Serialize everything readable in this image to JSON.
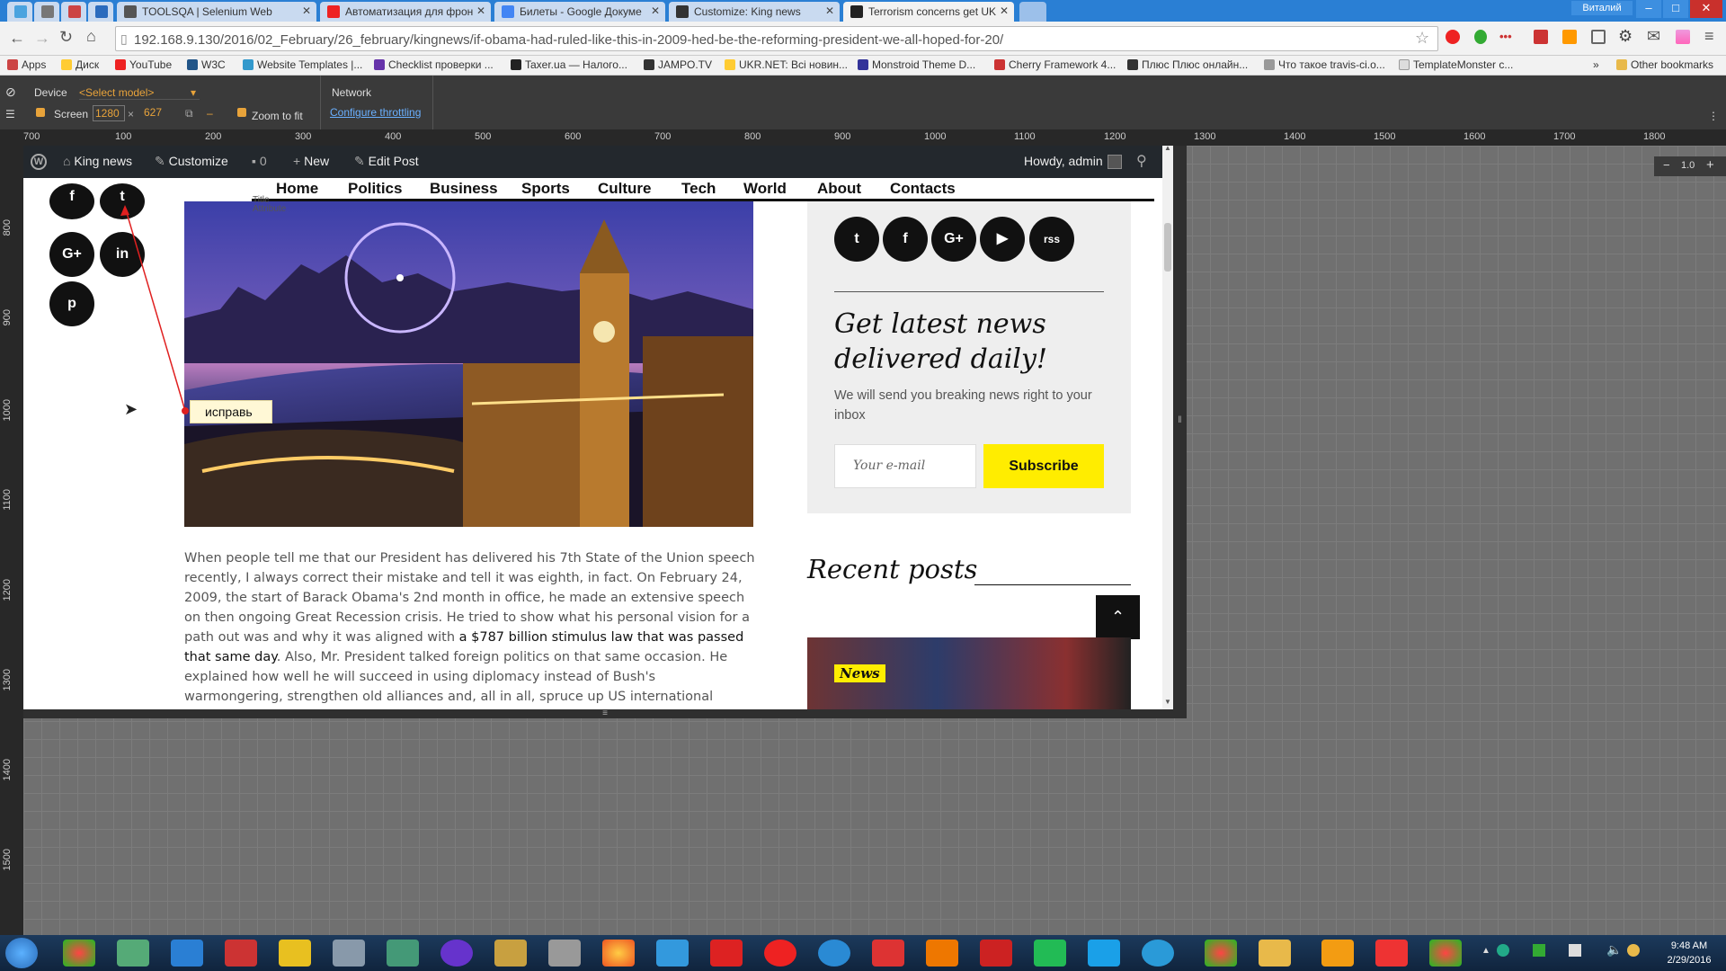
{
  "tabs": [
    {
      "label": "",
      "color": "#4aa3df"
    },
    {
      "label": "",
      "color": "#777"
    },
    {
      "label": "",
      "color": "#c44"
    },
    {
      "label": "",
      "color": "#2b6bbd"
    },
    {
      "label": "TOOLSQA | Selenium Web",
      "color": "#555"
    },
    {
      "label": "Автоматизация для фрон",
      "color": "#e22"
    },
    {
      "label": "Билеты - Google Докуме",
      "color": "#4285f4"
    },
    {
      "label": "Customize: King news",
      "color": "#333"
    },
    {
      "label": "Terrorism concerns get UK",
      "color": "#222"
    }
  ],
  "window": {
    "user": "Виталий",
    "min": "–",
    "max": "□",
    "close": "✕"
  },
  "address": {
    "url": "192.168.9.130/2016/02_February/26_february/kingnews/if-obama-had-ruled-like-this-in-2009-hed-be-the-reforming-president-we-all-hoped-for-20/"
  },
  "bookmarks": [
    "Apps",
    "Диск",
    "YouTube",
    "W3C",
    "Website Templates |...",
    "Checklist проверки ...",
    "Taxer.ua — Налого...",
    "JAMPO.TV",
    "UKR.NET: Всі новин...",
    "Monstroid Theme D...",
    "Cherry Framework 4...",
    "Плюс Плюс онлайн...",
    "Что такое travis-ci.o...",
    "TemplateMonster c...",
    "»",
    "Other bookmarks"
  ],
  "device": {
    "label": "Device",
    "model": "<Select model>",
    "screen_label": "Screen",
    "width": "1280",
    "height": "627",
    "zoom_label": "Zoom to fit",
    "network_label": "Network",
    "throttle": "Configure throttling"
  },
  "ruler_top": [
    "700",
    "100",
    "200",
    "300",
    "400",
    "500",
    "600",
    "700",
    "800",
    "900",
    "1000",
    "1100",
    "1200",
    "1300",
    "1400",
    "1500",
    "1600",
    "1700",
    "1800"
  ],
  "ruler_left": [
    "800",
    "900",
    "1000",
    "1100",
    "1200",
    "1300",
    "1400",
    "1500"
  ],
  "zoom": {
    "minus": "−",
    "value": "1.0",
    "plus": "+"
  },
  "wp": {
    "site": "King news",
    "customize": "Customize",
    "comments": "0",
    "new": "New",
    "edit": "Edit Post",
    "howdy": "Howdy, admin"
  },
  "nav": [
    "Home",
    "Politics",
    "Business",
    "Sports",
    "Culture",
    "Tech",
    "World",
    "About",
    "Contacts"
  ],
  "nav_tooltip": [
    "Title",
    "Attribute"
  ],
  "share_icons": [
    "f",
    "t",
    "G+",
    "in",
    "p"
  ],
  "sidebar": {
    "social": [
      "t",
      "f",
      "G+",
      "▶",
      "rss"
    ],
    "heading": "Get latest news delivered daily!",
    "sub": "We will send you breaking news right to your inbox",
    "email_ph": "Your e-mail",
    "subscribe": "Subscribe",
    "recent": "Recent posts",
    "badge": "News"
  },
  "annotation": "исправь",
  "article": {
    "p1": "When people tell me that our President has delivered his 7th State of the Union speech recently, I always correct their mistake and tell it was eighth, in fact. On February 24, 2009, the start of Barack Obama's 2nd month in office, he made an extensive speech on then ongoing Great Recession crisis. He tried to show what his personal vision for a path out was and why it was aligned with",
    "link": "a $787 billion stimulus law that was passed that same day",
    "p2": ". Also, Mr. President talked foreign politics on that same occasion. He explained how well he will succeed in using diplomacy instead of Bush's warmongering, strengthen old alliances and, all in all, spruce up US international image to a better one. He said: \"living our"
  },
  "clock": {
    "time": "9:48 AM",
    "date": "2/29/2016"
  },
  "colors": {
    "accent": "#ffed00",
    "wpbar": "#23282d",
    "chrome_blue": "#2a7fd4"
  }
}
